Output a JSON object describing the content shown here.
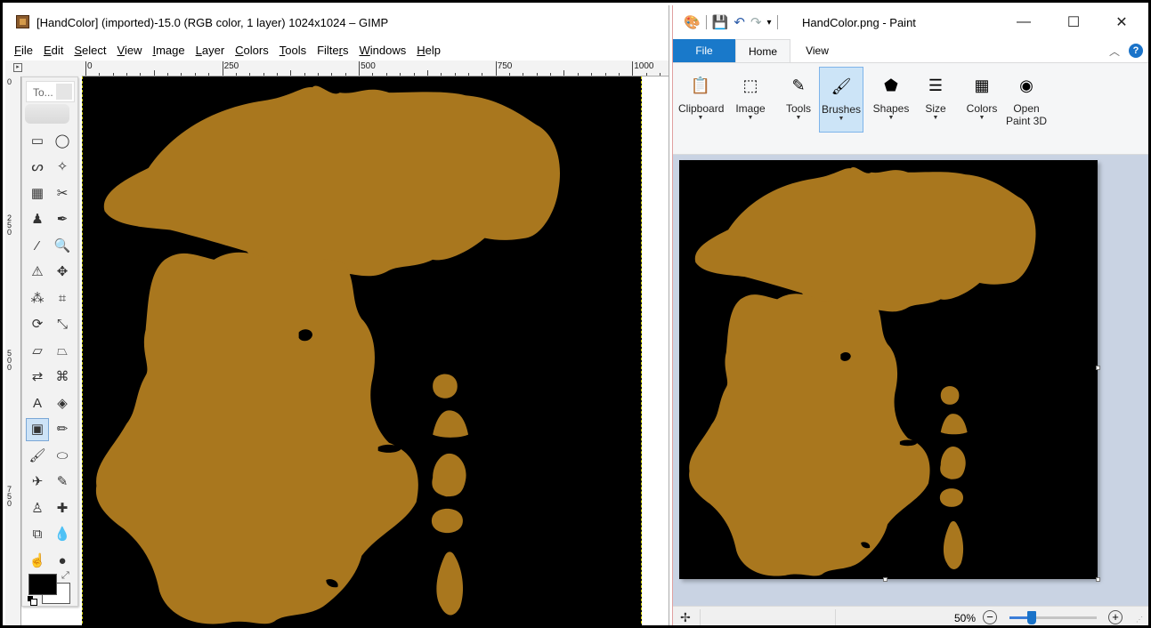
{
  "gimp": {
    "title": "[HandColor] (imported)-15.0 (RGB color, 1 layer) 1024x1024 – GIMP",
    "menu": [
      {
        "key": "F",
        "rest": "ile"
      },
      {
        "key": "E",
        "rest": "dit"
      },
      {
        "key": "S",
        "rest": "elect"
      },
      {
        "key": "V",
        "rest": "iew"
      },
      {
        "key": "I",
        "rest": "mage"
      },
      {
        "key": "L",
        "rest": "ayer"
      },
      {
        "key": "C",
        "rest": "olors"
      },
      {
        "key": "T",
        "rest": "ools"
      },
      {
        "key": "Filte",
        "rest": "rs",
        "underline_second": true
      },
      {
        "key": "W",
        "rest": "indows"
      },
      {
        "key": "H",
        "rest": "elp"
      }
    ],
    "hruler_labels": [
      "0",
      "250",
      "500",
      "750",
      "1000"
    ],
    "vruler_labels": [
      "0",
      "250",
      "500",
      "750"
    ],
    "toolbox_title": "To...",
    "fg_color": "#000000",
    "bg_color": "#ffffff",
    "canvas_bg": "#000000",
    "shape_color": "#a9771e",
    "tools": [
      {
        "name": "rect-select-icon",
        "glyph": "▭"
      },
      {
        "name": "ellipse-select-icon",
        "glyph": "◯"
      },
      {
        "name": "free-select-icon",
        "glyph": "ᔕ"
      },
      {
        "name": "fuzzy-select-icon",
        "glyph": "✧"
      },
      {
        "name": "select-by-color-icon",
        "glyph": "▦"
      },
      {
        "name": "scissors-select-icon",
        "glyph": "✂"
      },
      {
        "name": "foreground-select-icon",
        "glyph": "♟"
      },
      {
        "name": "paths-icon",
        "glyph": "✒"
      },
      {
        "name": "color-picker-icon",
        "glyph": "⁄"
      },
      {
        "name": "zoom-icon",
        "glyph": "🔍"
      },
      {
        "name": "measure-icon",
        "glyph": "⚠"
      },
      {
        "name": "move-icon",
        "glyph": "✥"
      },
      {
        "name": "align-icon",
        "glyph": "⁂"
      },
      {
        "name": "crop-icon",
        "glyph": "⌗"
      },
      {
        "name": "rotate-icon",
        "glyph": "⟳"
      },
      {
        "name": "scale-icon",
        "glyph": "⤡"
      },
      {
        "name": "shear-icon",
        "glyph": "▱"
      },
      {
        "name": "perspective-icon",
        "glyph": "⏢"
      },
      {
        "name": "flip-icon",
        "glyph": "⇄"
      },
      {
        "name": "cage-transform-icon",
        "glyph": "⌘"
      },
      {
        "name": "text-icon",
        "glyph": "A"
      },
      {
        "name": "bucket-fill-icon",
        "glyph": "◈"
      },
      {
        "name": "blend-icon",
        "glyph": "▣"
      },
      {
        "name": "pencil-icon",
        "glyph": "✏"
      },
      {
        "name": "paintbrush-icon",
        "glyph": "🖌"
      },
      {
        "name": "eraser-icon",
        "glyph": "⬭"
      },
      {
        "name": "airbrush-icon",
        "glyph": "✈"
      },
      {
        "name": "ink-icon",
        "glyph": "✎"
      },
      {
        "name": "clone-icon",
        "glyph": "♙"
      },
      {
        "name": "heal-icon",
        "glyph": "✚"
      },
      {
        "name": "perspective-clone-icon",
        "glyph": "⧉"
      },
      {
        "name": "blur-icon",
        "glyph": "💧"
      },
      {
        "name": "smudge-icon",
        "glyph": "☝"
      },
      {
        "name": "dodge-burn-icon",
        "glyph": "●"
      }
    ]
  },
  "paint": {
    "title": "HandColor.png - Paint",
    "tabs": {
      "file": "File",
      "home": "Home",
      "view": "View"
    },
    "ribbon": [
      {
        "id": "clipboard",
        "label": "Clipboard",
        "icon": "clipboard-icon",
        "glyph": "📋",
        "caret": true
      },
      {
        "id": "image",
        "label": "Image",
        "icon": "image-select-icon",
        "glyph": "⬚",
        "caret": true
      },
      {
        "id": "tools",
        "label": "Tools",
        "icon": "tools-icon",
        "glyph": "✎",
        "caret": true
      },
      {
        "id": "brushes",
        "label": "Brushes",
        "icon": "brushes-icon",
        "glyph": "🖌",
        "caret": true
      },
      {
        "id": "shapes",
        "label": "Shapes",
        "icon": "shapes-icon",
        "glyph": "⬟",
        "caret": true
      },
      {
        "id": "size",
        "label": "Size",
        "icon": "size-icon",
        "glyph": "☰",
        "caret": true
      },
      {
        "id": "colors",
        "label": "Colors",
        "icon": "colors-icon",
        "glyph": "▦",
        "caret": true
      },
      {
        "id": "paint3d",
        "label": "Open\nPaint 3D",
        "icon": "paint3d-icon",
        "glyph": "◉",
        "caret": false
      }
    ],
    "zoom": "50%",
    "zoom_fraction": 0.25,
    "canvas_bg": "#000000",
    "shape_color": "#a9771e",
    "accent": "#1979ca"
  }
}
